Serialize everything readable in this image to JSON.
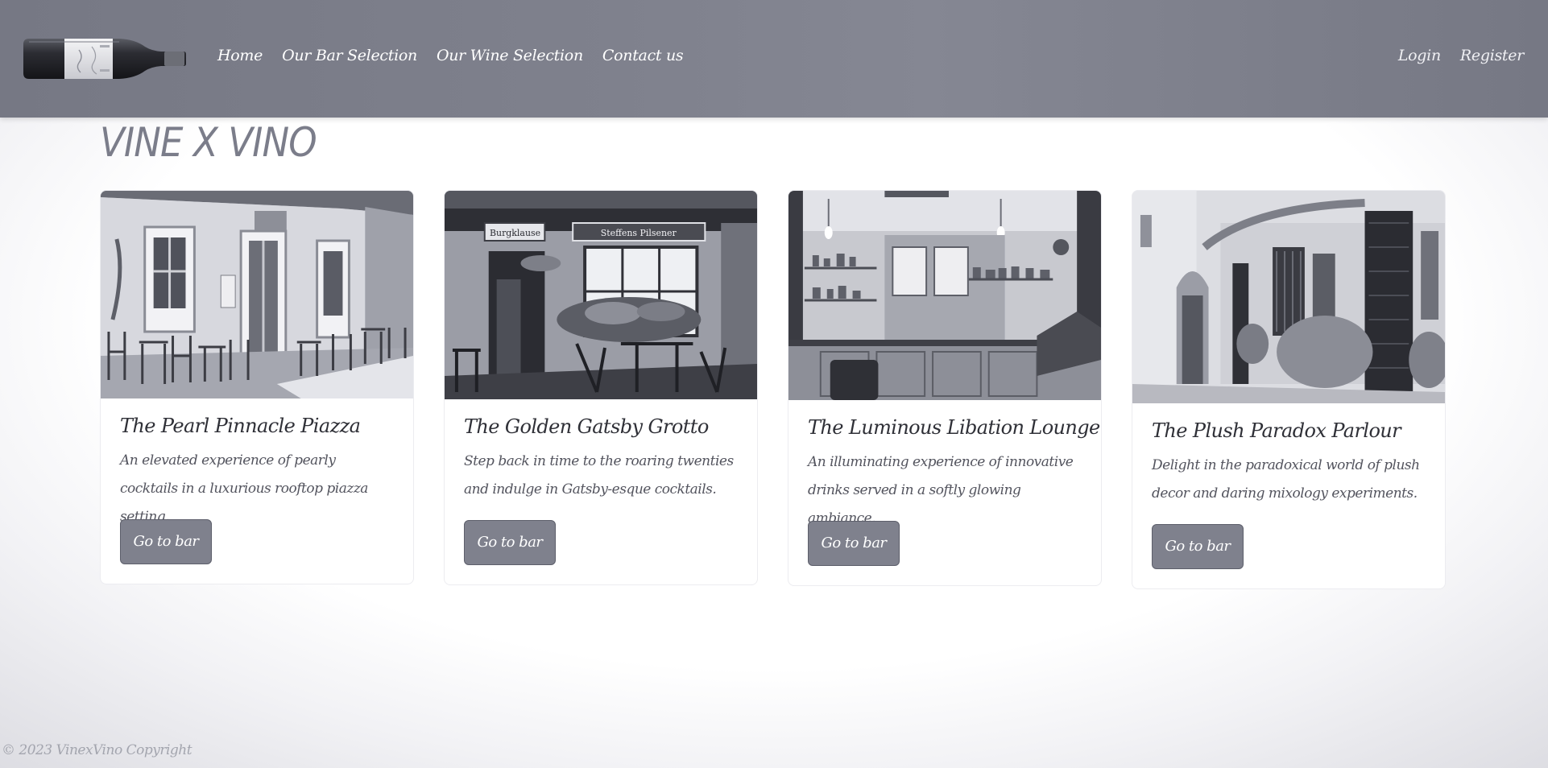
{
  "nav": {
    "brand_icon": "wine-bottle-icon",
    "links": [
      "Home",
      "Our Bar Selection",
      "Our Wine Selection",
      "Contact us"
    ],
    "auth": {
      "login": "Login",
      "register": "Register"
    }
  },
  "site_title": "VINE X VINO",
  "cards": [
    {
      "title": "The Pearl Pinnacle Piazza",
      "text": "An elevated experience of pearly cocktails in a luxurious rooftop piazza setting.",
      "button": "Go to bar",
      "image": "outdoor-cafe-terrace-photo"
    },
    {
      "title": "The Golden Gatsby Grotto",
      "text": "Step back in time to the roaring twenties and indulge in Gatsby-esque cocktails.",
      "button": "Go to bar",
      "image": "pub-storefront-photo"
    },
    {
      "title": "The Luminous Libation Lounge",
      "text": "An illuminating experience of innovative drinks served in a softly glowing ambiance.",
      "button": "Go to bar",
      "image": "bar-interior-photo"
    },
    {
      "title": "The Plush Paradox Parlour",
      "text": "Delight in the paradoxical world of plush decor and daring mixology experiments.",
      "button": "Go to bar",
      "image": "flowered-street-photo"
    }
  ],
  "footer": "© 2023 VinexVino Copyright",
  "colors": {
    "navbar": "#7f818d",
    "button": "#7f818d",
    "title": "#7b7d8a"
  }
}
